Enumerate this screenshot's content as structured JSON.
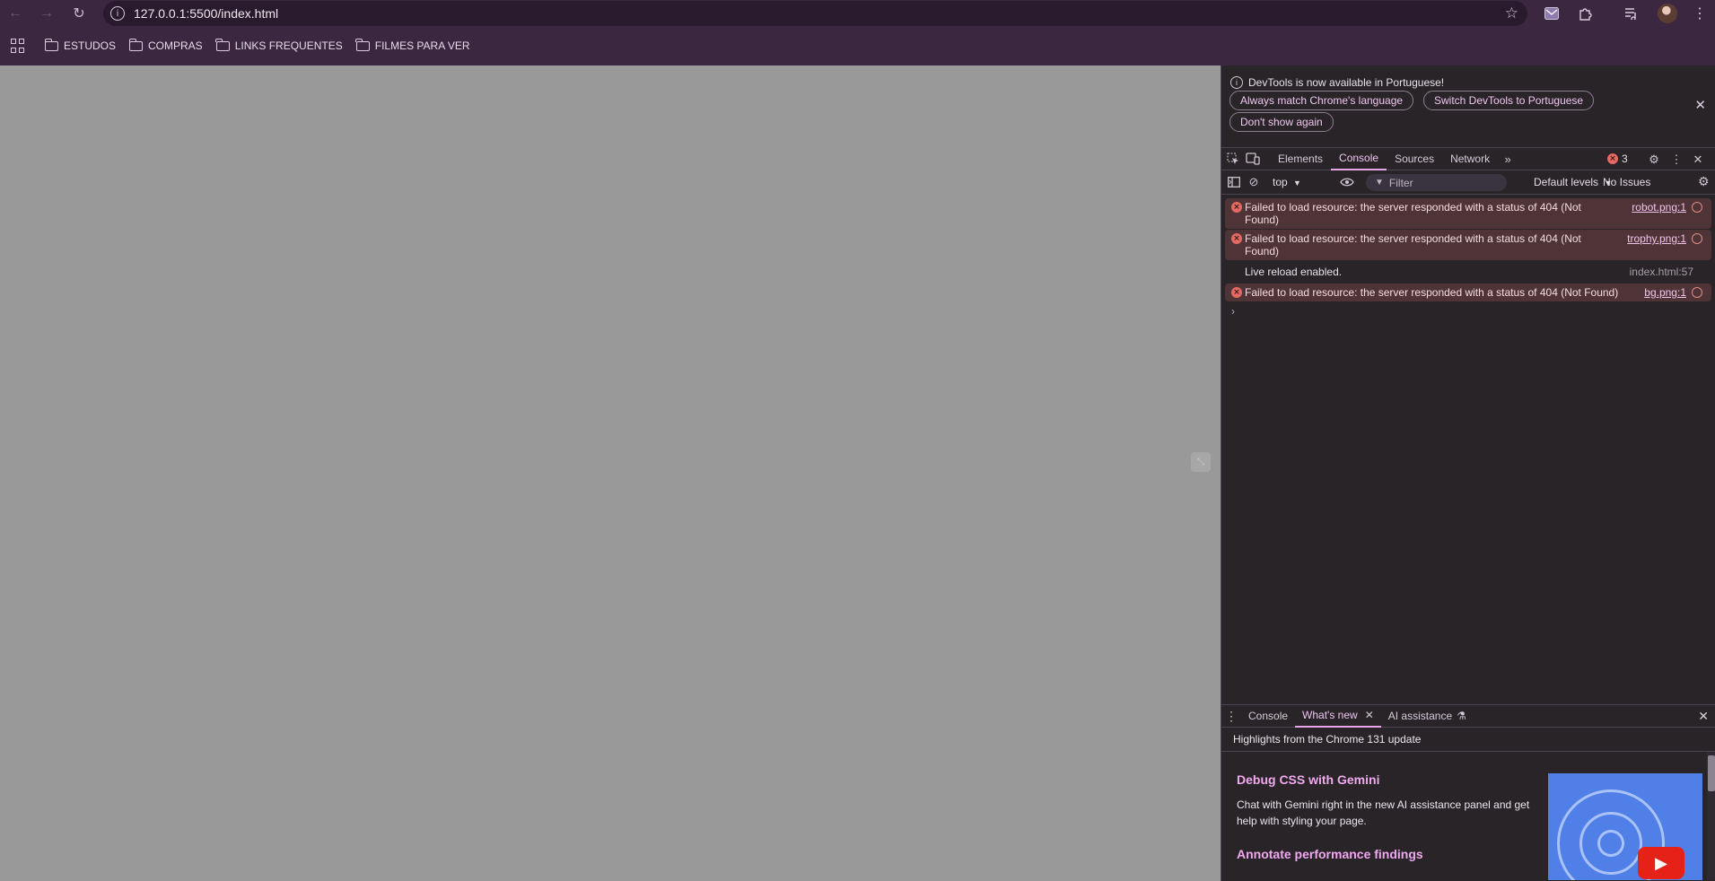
{
  "browser": {
    "url": "127.0.0.1:5500/index.html",
    "bookmarks": [
      "ESTUDOS",
      "COMPRAS",
      "LINKS FREQUENTES",
      "FILMES PARA VER"
    ]
  },
  "devtools": {
    "infobar": {
      "message": "DevTools is now available in Portuguese!",
      "btn_match": "Always match Chrome's language",
      "btn_switch": "Switch DevTools to Portuguese",
      "btn_dont_show": "Don't show again"
    },
    "tabs": {
      "elements": "Elements",
      "console": "Console",
      "sources": "Sources",
      "network": "Network"
    },
    "error_count": "3",
    "console_toolbar": {
      "context": "top",
      "filter_placeholder": "Filter",
      "levels": "Default levels",
      "issues": "No Issues"
    },
    "log": [
      {
        "type": "error",
        "text": "Failed to load resource: the server responded with a status of 404 (Not Found)",
        "source": "robot.png:1"
      },
      {
        "type": "error",
        "text": "Failed to load resource: the server responded with a status of 404 (Not Found)",
        "source": "trophy.png:1"
      },
      {
        "type": "info",
        "text": "Live reload enabled.",
        "source": "index.html:57"
      },
      {
        "type": "error",
        "text": "Failed to load resource: the server responded with a status of 404 (Not Found)",
        "source": "bg.png:1"
      }
    ],
    "drawer": {
      "tabs": {
        "console": "Console",
        "whats_new": "What's new",
        "ai": "AI assistance"
      },
      "highlights": "Highlights from the Chrome 131 update",
      "feature1_title": "Debug CSS with Gemini",
      "feature1_desc": "Chat with Gemini right in the new AI assistance panel and get help with styling your page.",
      "feature2_title": "Annotate performance findings"
    }
  },
  "colors": {
    "chrome_bg": "#3c2740",
    "page_bg": "#999999",
    "devtools_bg": "#282428",
    "accent": "#f0c3ef",
    "error_row": "#4e3437"
  }
}
